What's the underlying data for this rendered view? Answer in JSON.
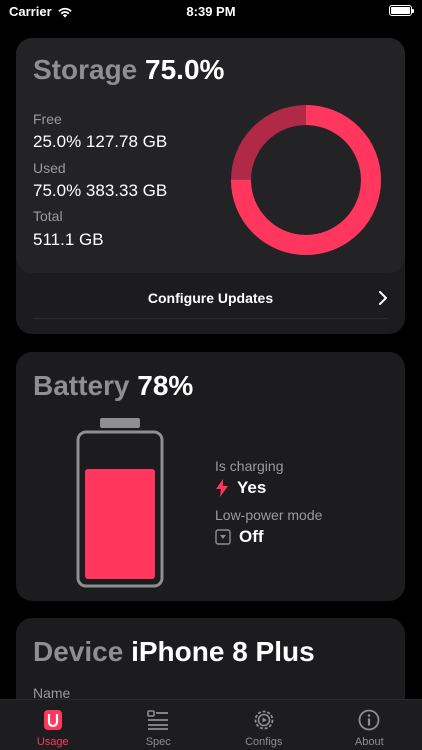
{
  "status_bar": {
    "carrier": "Carrier",
    "time": "8:39 PM",
    "battery_level": 1.0
  },
  "storage": {
    "title": "Storage",
    "percent": "75.0%",
    "free_label": "Free",
    "free_value": "25.0% 127.78 GB",
    "used_label": "Used",
    "used_value": "75.0% 383.33 GB",
    "total_label": "Total",
    "total_value": "511.1 GB",
    "used_fraction": 0.75,
    "configure_label": "Configure Updates"
  },
  "battery": {
    "title": "Battery",
    "percent": "78%",
    "level_fraction": 0.78,
    "charging_label": "Is charging",
    "charging_value": "Yes",
    "low_power_label": "Low-power mode",
    "low_power_value": "Off"
  },
  "device": {
    "title": "Device",
    "model": "iPhone 8 Plus",
    "name_label": "Name"
  },
  "tabs": [
    {
      "label": "Usage",
      "icon": "usage-icon",
      "active": true
    },
    {
      "label": "Spec",
      "icon": "spec-icon",
      "active": false
    },
    {
      "label": "Configs",
      "icon": "configs-icon",
      "active": false
    },
    {
      "label": "About",
      "icon": "about-icon",
      "active": false
    }
  ],
  "colors": {
    "accent": "#ff375f",
    "accent_dim": "#b02a47",
    "card": "#1c1c1e",
    "background": "#000000"
  }
}
